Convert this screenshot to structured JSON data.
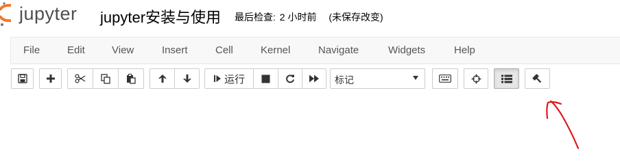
{
  "header": {
    "logo_text": "jupyter",
    "notebook_title": "jupyter安装与使用",
    "checkpoint_label": "最后检查:",
    "checkpoint_time": "2 小时前",
    "autosave_status": "(未保存改变)"
  },
  "menubar": {
    "items": [
      "File",
      "Edit",
      "View",
      "Insert",
      "Cell",
      "Kernel",
      "Navigate",
      "Widgets",
      "Help"
    ]
  },
  "toolbar": {
    "run_label": "运行",
    "cell_type_selected": "标记",
    "buttons": [
      "save-icon",
      "plus-icon",
      "cut-icon",
      "copy-icon",
      "paste-icon",
      "arrow-up-icon",
      "arrow-down-icon",
      "step-forward-icon",
      "stop-icon",
      "refresh-icon",
      "fast-forward-icon",
      "keyboard-icon",
      "crosshairs-icon",
      "list-icon",
      "gavel-icon"
    ]
  },
  "colors": {
    "logo_orange": "#F37726",
    "annotation_red": "#E01818",
    "menubar_bg": "#f8f8f8"
  }
}
